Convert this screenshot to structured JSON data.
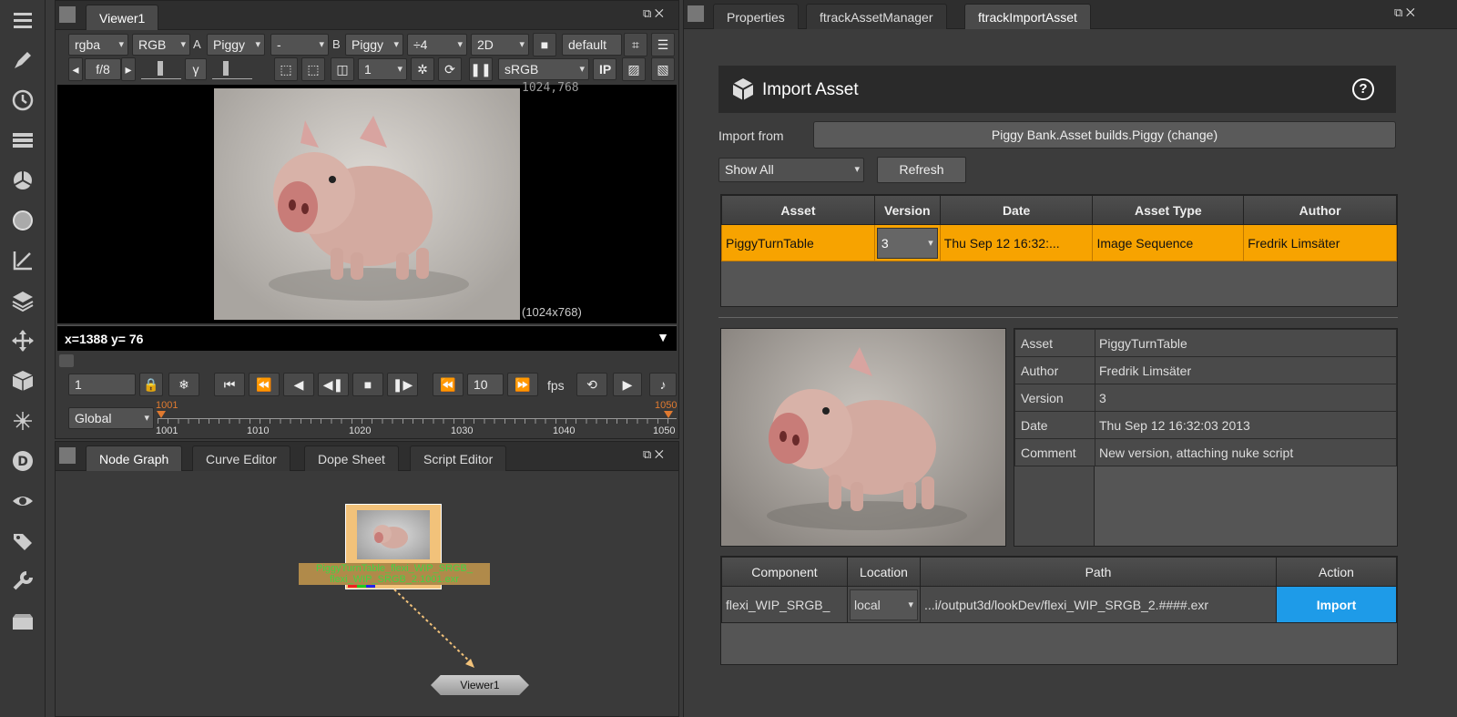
{
  "sidebar": {
    "tools": [
      "menu-icon",
      "pen-icon",
      "clock-icon",
      "layers-stack-icon",
      "channel-pie-icon",
      "sphere-icon",
      "transform-axis-icon",
      "stack-icon",
      "move-icon",
      "cube-icon",
      "particles-icon",
      "d-icon",
      "eye-icon",
      "tags-icon",
      "wrench-icon",
      "folder-icon"
    ]
  },
  "viewer": {
    "tab": "Viewer1",
    "row1": {
      "channels": "rgba",
      "layer": "RGB",
      "a_label": "A",
      "input_a": "Piggy",
      "blend": "-",
      "b_label": "B",
      "input_b": "Piggy",
      "proxy": "÷4",
      "mode": "2D",
      "preset": "default"
    },
    "row2": {
      "fstop": "f/8",
      "gamma": "γ",
      "count": "1",
      "colorspace": "sRGB",
      "ip": "IP"
    },
    "res_top": "1024,768",
    "res_bottom": "(1024x768)",
    "coords": "x=1388 y=  76",
    "frame": "1",
    "increment": "10",
    "fps": "fps",
    "range": "Global",
    "timeline": {
      "start_marker": "1001",
      "end_marker": "1050",
      "ticks": [
        "1001",
        "1010",
        "1020",
        "1030",
        "1040",
        "1050"
      ]
    }
  },
  "nodegraph": {
    "tabs": [
      "Node Graph",
      "Curve Editor",
      "Dope Sheet",
      "Script Editor"
    ],
    "read_label_1": "PiggyTurnTable_flexi_WIP_SRGB_",
    "read_label_2": "flexi_WIP_SRGB_2.1001.exr",
    "viewer_node": "Viewer1"
  },
  "right": {
    "tabs": [
      "Properties",
      "ftrackAssetManager",
      "ftrackImportAsset"
    ],
    "header_title": "Import Asset",
    "help": "?",
    "import_from_label": "Import from",
    "import_from_value": "Piggy Bank.Asset builds.Piggy (change)",
    "filter": "Show All",
    "refresh": "Refresh",
    "asset_table": {
      "headers": [
        "Asset",
        "Version",
        "Date",
        "Asset Type",
        "Author"
      ],
      "row": [
        "PiggyTurnTable",
        "3",
        "Thu Sep 12 16:32:...",
        "Image Sequence",
        "Fredrik Limsäter"
      ]
    },
    "details": [
      {
        "key": "Asset",
        "value": "PiggyTurnTable"
      },
      {
        "key": "Author",
        "value": "Fredrik Limsäter"
      },
      {
        "key": "Version",
        "value": "3"
      },
      {
        "key": "Date",
        "value": "Thu Sep 12 16:32:03 2013"
      },
      {
        "key": "Comment",
        "value": "New version, attaching nuke script"
      }
    ],
    "component_table": {
      "headers": [
        "Component",
        "Location",
        "Path",
        "Action"
      ],
      "row": {
        "component": "flexi_WIP_SRGB_",
        "location": "local",
        "path": "...i/output3d/lookDev/flexi_WIP_SRGB_2.####.exr",
        "action": "Import"
      }
    }
  },
  "colors": {
    "accent_orange": "#f7a300",
    "import_blue": "#1e9be8",
    "node_green": "#44d244"
  }
}
